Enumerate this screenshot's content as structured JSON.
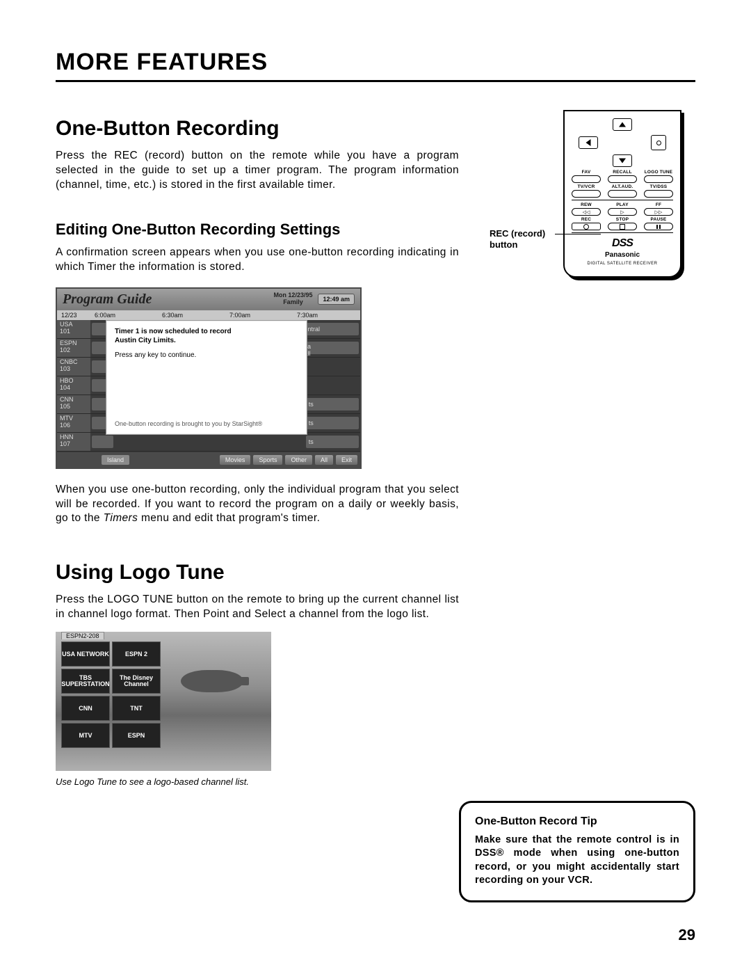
{
  "header": "MORE FEATURES",
  "section1": {
    "title": "One-Button Recording",
    "para1": "Press the REC (record) button on the remote while you have a program selected in the guide to set up a timer program. The program information (channel, time, etc.) is stored in the first available timer.",
    "subtitle": "Editing One-Button Recording Settings",
    "para2": "A confirmation screen appears when you use one-button recording indicating in which Timer the information is stored.",
    "para3_a": "When you use one-button recording, only the individual program that you select will be recorded. If you want to record the program on a daily or weekly basis, go to the ",
    "para3_timers": "Timers",
    "para3_b": " menu and edit that program's timer."
  },
  "guide": {
    "title": "Program Guide",
    "date1": "Mon 12/23/95",
    "date2": "Family",
    "clock": "12:49 am",
    "col_date": "12/23",
    "cols": [
      "6:00am",
      "6:30am",
      "7:00am",
      "7:30am"
    ],
    "channels": [
      {
        "name": "USA",
        "num": "101"
      },
      {
        "name": "ESPN",
        "num": "102"
      },
      {
        "name": "CNBC",
        "num": "103"
      },
      {
        "name": "HBO",
        "num": "104"
      },
      {
        "name": "CNN",
        "num": "105"
      },
      {
        "name": "MTV",
        "num": "106"
      },
      {
        "name": "HNN",
        "num": "107"
      }
    ],
    "row0_right": "et Central",
    "row1_right": "larissa",
    "row1_right2": "ells All",
    "row4_right": "ts",
    "row5_right": "ts",
    "row6_right": "ts",
    "popup": {
      "l1": "Timer 1 is now scheduled to record",
      "l2": "Austin City Limits.",
      "l3": "Press any key to continue.",
      "l4": "One-button recording is brought to you by StarSight®"
    },
    "bottom": [
      "Island",
      "Movies",
      "Sports",
      "Other",
      "All",
      "Exit"
    ]
  },
  "section2": {
    "title": "Using Logo Tune",
    "para1": "Press the LOGO TUNE button on the remote to bring up the current channel list in channel logo format. Then Point and Select a channel from the logo list.",
    "caption": "Use Logo Tune to see a logo-based channel list."
  },
  "logo": {
    "header": "ESPN2-208",
    "cells": [
      "USA\nNETWORK",
      "ESPN\n2",
      "TBS\nSUPERSTATION",
      "The\nDisney\nChannel",
      "CNN",
      "TNT",
      "MTV",
      "ESPN"
    ]
  },
  "remote": {
    "callout": "REC (record) button",
    "row1": [
      "FAV",
      "RECALL",
      "LOGO TUNE"
    ],
    "row2": [
      "TV/VCR",
      "ALT.AUD.",
      "TV/DSS"
    ],
    "row3": [
      "REW",
      "PLAY",
      "FF"
    ],
    "row4": [
      "REC",
      "STOP",
      "PAUSE"
    ],
    "brand1": "DSS",
    "brand2": "Panasonic",
    "sub": "DIGITAL SATELLITE\nRECEIVER"
  },
  "tip": {
    "title": "One-Button Record Tip",
    "body": "Make sure that the remote control is in DSS® mode when using one-button record, or you might accidentally start recording on your VCR."
  },
  "page": "29"
}
